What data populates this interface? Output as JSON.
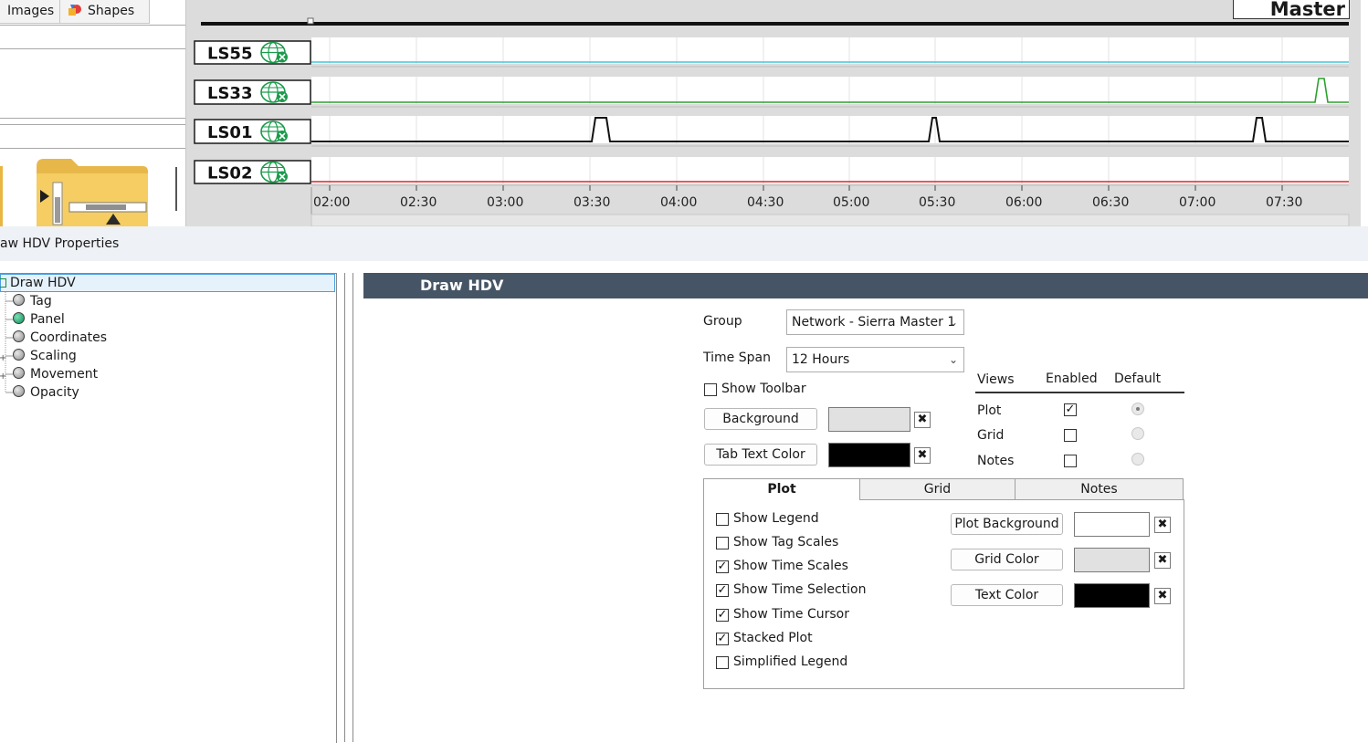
{
  "palette": {
    "tabs": [
      "Images",
      "Shapes"
    ]
  },
  "trend": {
    "title": "Master",
    "tags": [
      {
        "name": "LS55",
        "color": "#43c6d8"
      },
      {
        "name": "LS33",
        "color": "#2ca02c"
      },
      {
        "name": "LS01",
        "color": "#111111"
      },
      {
        "name": "LS02",
        "color": "#d62728"
      }
    ],
    "time_labels": [
      "02:00",
      "02:30",
      "03:00",
      "03:30",
      "04:00",
      "04:30",
      "05:00",
      "05:30",
      "06:00",
      "06:30",
      "07:00",
      "07:30"
    ]
  },
  "properties": {
    "title": "aw HDV Properties"
  },
  "tree": {
    "root": "Draw HDV",
    "items": [
      "Tag",
      "Panel",
      "Coordinates",
      "Scaling",
      "Movement",
      "Opacity"
    ]
  },
  "panel": {
    "header": "Draw HDV",
    "group_label": "Group",
    "group_value": "Network - Sierra Master 1",
    "timespan_label": "Time Span",
    "timespan_value": "12 Hours",
    "show_toolbar_label": "Show Toolbar",
    "show_toolbar": false,
    "background_label": "Background",
    "background_color": "#e1e1e1",
    "tab_text_color_label": "Tab Text Color",
    "tab_text_color": "#000000",
    "views": {
      "col_views": "Views",
      "col_enabled": "Enabled",
      "col_default": "Default",
      "rows": [
        {
          "name": "Plot",
          "enabled": true,
          "default": true
        },
        {
          "name": "Grid",
          "enabled": false,
          "default": false
        },
        {
          "name": "Notes",
          "enabled": false,
          "default": false
        }
      ]
    },
    "tabs": [
      "Plot",
      "Grid",
      "Notes"
    ],
    "active_tab": "Plot",
    "plot_options": [
      {
        "label": "Show Legend",
        "checked": false
      },
      {
        "label": "Show Tag Scales",
        "checked": false
      },
      {
        "label": "Show Time Scales",
        "checked": true
      },
      {
        "label": "Show Time Selection",
        "checked": true
      },
      {
        "label": "Show Time Cursor",
        "checked": true
      },
      {
        "label": "Stacked Plot",
        "checked": true
      },
      {
        "label": "Simplified Legend",
        "checked": false
      }
    ],
    "plot_background_label": "Plot Background",
    "plot_background_color": "#ffffff",
    "grid_color_label": "Grid Color",
    "grid_color": "#e1e1e1",
    "text_color_label": "Text Color",
    "text_color": "#000000"
  },
  "icons": {
    "tag_status": "globe-x-icon",
    "clear": "x-icon",
    "folder": "folder-icon"
  }
}
